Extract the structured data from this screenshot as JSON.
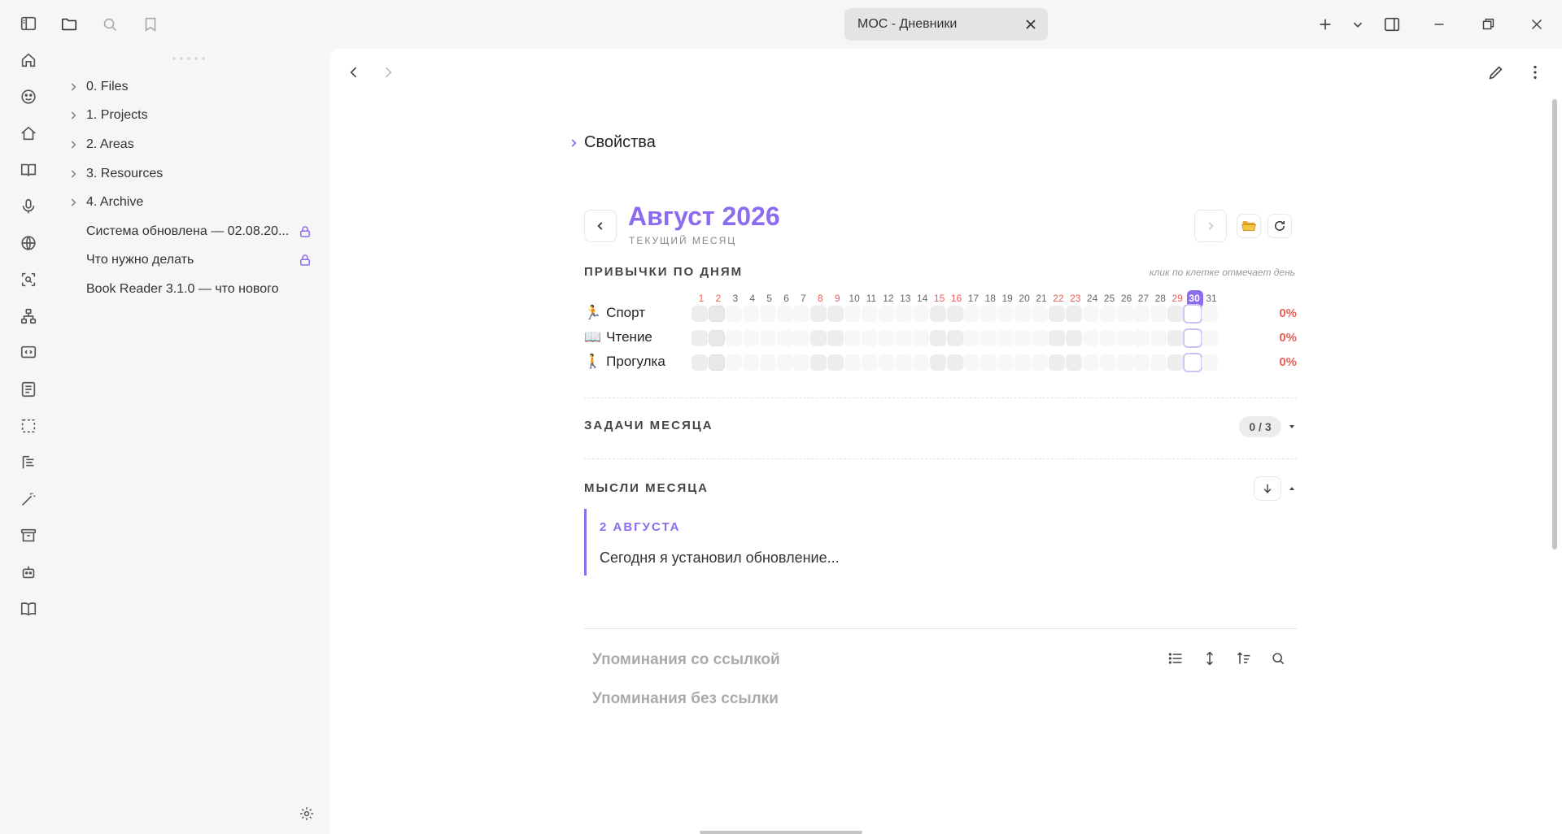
{
  "tab": {
    "title": "MOC - Дневники"
  },
  "sidebar": {
    "items": [
      {
        "label": "0. Files",
        "folder": true
      },
      {
        "label": "1. Projects",
        "folder": true
      },
      {
        "label": "2. Areas",
        "folder": true
      },
      {
        "label": "3. Resources",
        "folder": true
      },
      {
        "label": "4. Archive",
        "folder": true
      },
      {
        "label": "Система обновлена — 02.08.20...",
        "locked": true
      },
      {
        "label": "Что нужно делать",
        "locked": true
      },
      {
        "label": "Book Reader 3.1.0 — что нового"
      }
    ]
  },
  "note": {
    "properties_label": "Свойства",
    "month_title": "Август 2026",
    "month_subtitle": "ТЕКУЩИЙ МЕСЯЦ",
    "habits_header": "ПРИВЫЧКИ ПО ДНЯМ",
    "habits_hint": "клик по клетке отмечает день",
    "days": [
      "1",
      "2",
      "3",
      "4",
      "5",
      "6",
      "7",
      "8",
      "9",
      "10",
      "11",
      "12",
      "13",
      "14",
      "15",
      "16",
      "17",
      "18",
      "19",
      "20",
      "21",
      "22",
      "23",
      "24",
      "25",
      "26",
      "27",
      "28",
      "29",
      "30",
      "31"
    ],
    "weekend_days": [
      1,
      2,
      8,
      9,
      15,
      16,
      22,
      23,
      29
    ],
    "today": 30,
    "habits": [
      {
        "emoji": "🏃",
        "name": "Спорт",
        "pct": "0%"
      },
      {
        "emoji": "📖",
        "name": "Чтение",
        "pct": "0%"
      },
      {
        "emoji": "🚶",
        "name": "Прогулка",
        "pct": "0%"
      }
    ],
    "tasks_header": "ЗАДАЧИ МЕСЯЦА",
    "tasks_count": "0 / 3",
    "thoughts_header": "МЫСЛИ МЕСЯЦА",
    "thought_date": "2 АВГУСТА",
    "thought_text": "Сегодня я установил обновление...",
    "linked_mentions": "Упоминания со ссылкой",
    "unlinked_mentions": "Упоминания без ссылки"
  },
  "colors": {
    "accent": "#8b6cf0",
    "weekend": "#e8605a"
  },
  "icons": {
    "ribbon": [
      "home-icon",
      "smile-icon",
      "house-icon",
      "book-icon",
      "mic-icon",
      "globe-icon",
      "scan-icon",
      "network-icon",
      "code-message-icon",
      "list-icon",
      "dashed-square-icon",
      "calendar-icon",
      "magic-wand-icon",
      "archive-icon",
      "bot-icon",
      "open-book-icon"
    ]
  }
}
